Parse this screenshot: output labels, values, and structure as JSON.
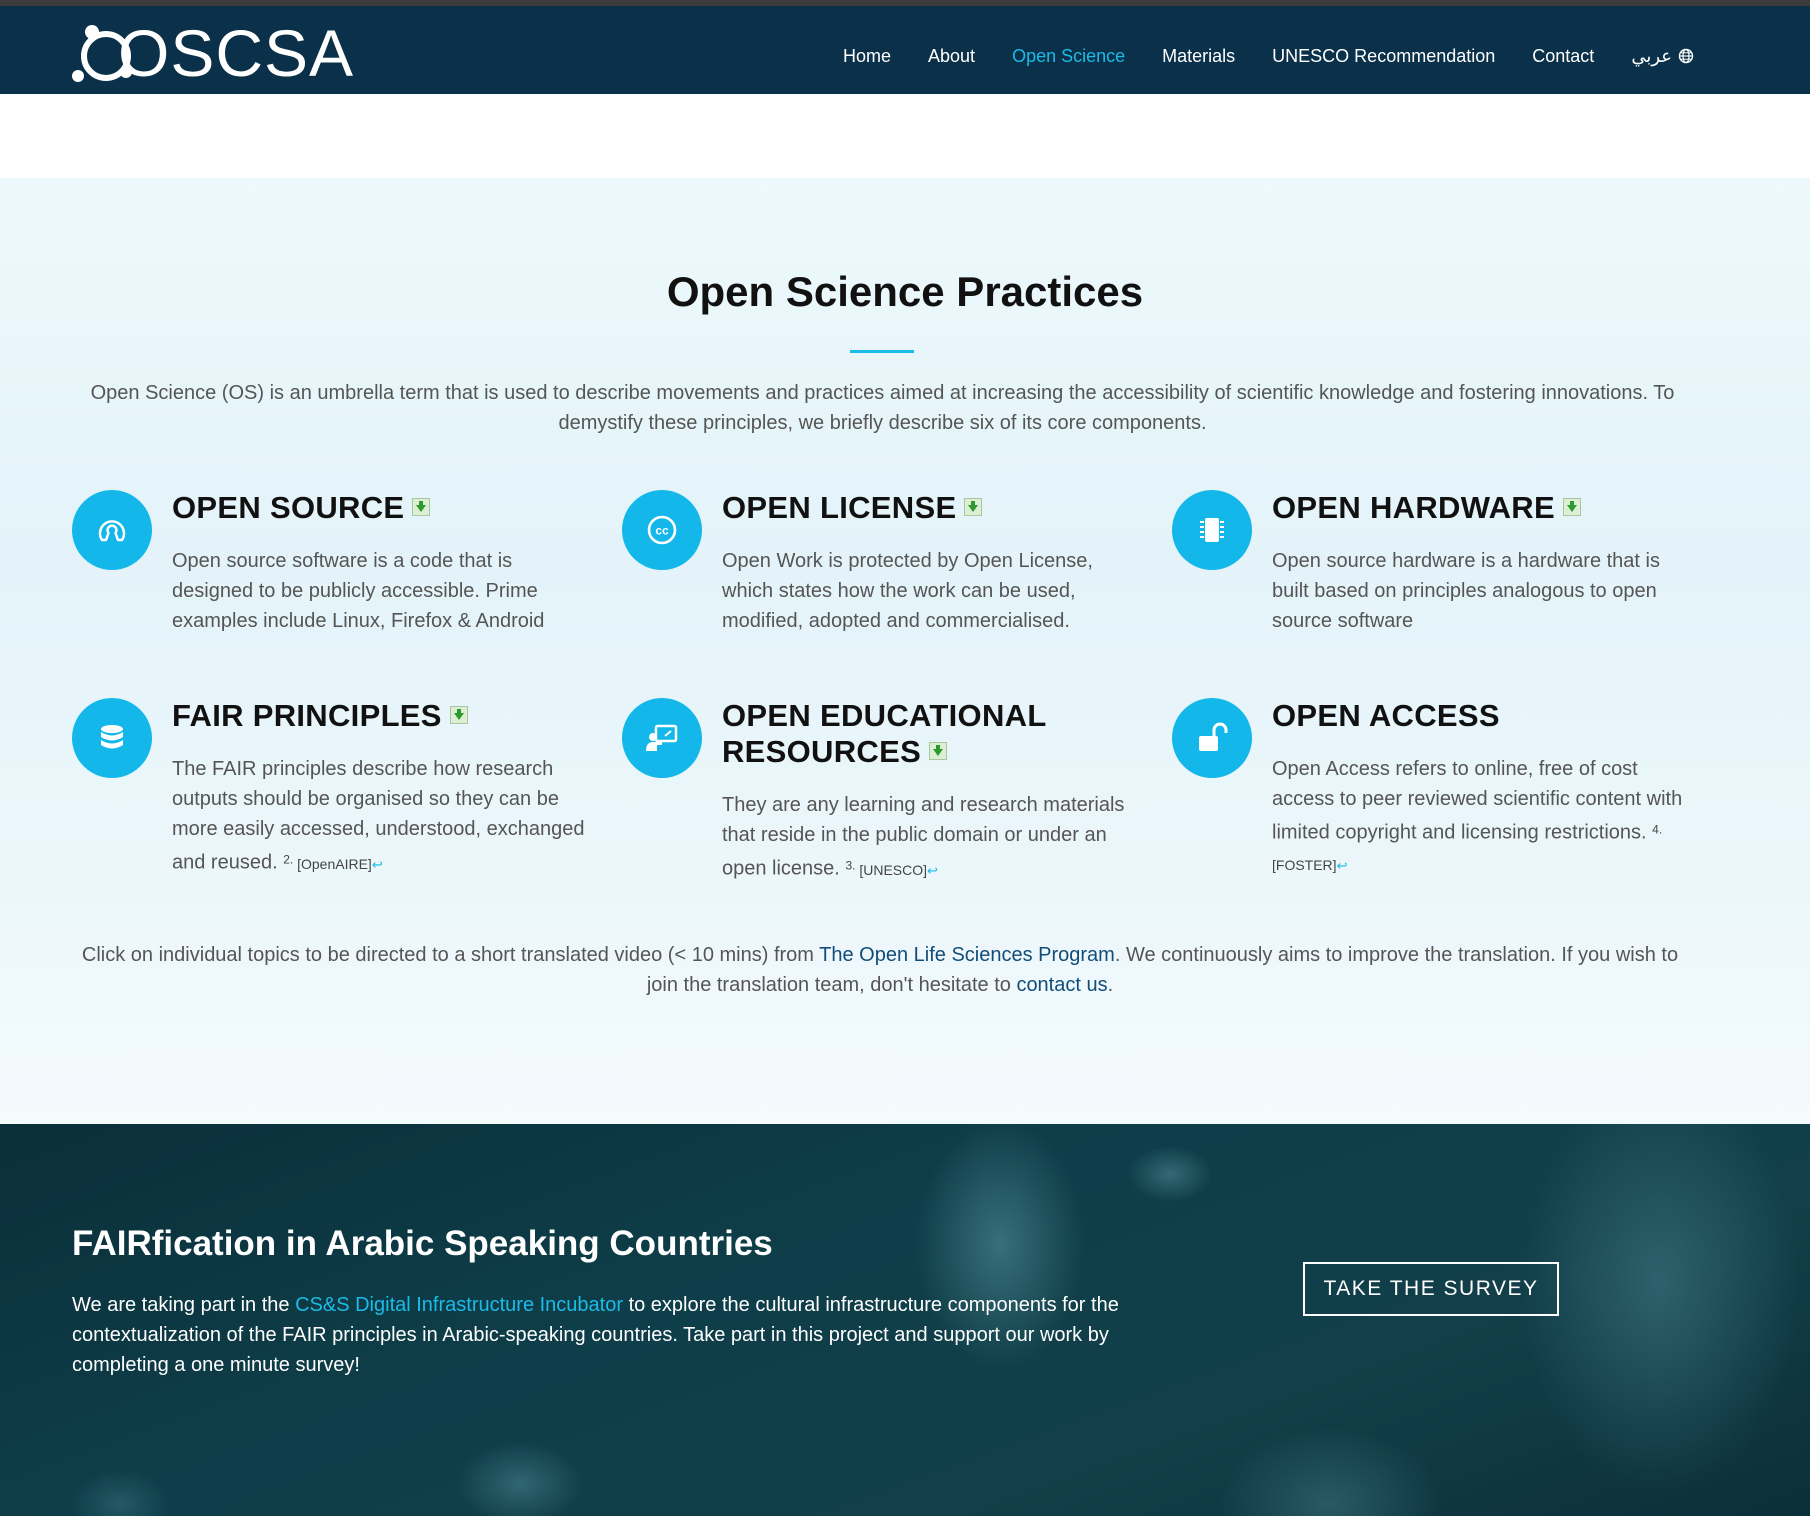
{
  "brand": {
    "name": "OSCSA"
  },
  "nav": {
    "items": [
      {
        "label": "Home",
        "active": false
      },
      {
        "label": "About",
        "active": false
      },
      {
        "label": "Open Science",
        "active": true
      },
      {
        "label": "Materials",
        "active": false
      },
      {
        "label": "UNESCO Recommendation",
        "active": false
      },
      {
        "label": "Contact",
        "active": false
      }
    ],
    "language": {
      "label": "عربي",
      "icon": "globe-icon"
    }
  },
  "practices": {
    "title": "Open Science Practices",
    "intro": "Open Science (OS) is an umbrella term that is used to describe movements and practices aimed at increasing the accessibility of scientific knowledge and fostering innovations. To demystify these principles, we briefly describe six of its core components.",
    "cards": [
      {
        "title": "OPEN SOURCE",
        "icon": "open-source-icon",
        "download": true,
        "text": "Open source software is a code that is designed to be publicly accessible. Prime examples include Linux, Firefox & Android"
      },
      {
        "title": "OPEN LICENSE",
        "icon": "creative-commons-icon",
        "download": true,
        "text": "Open Work is protected by Open License, which states how the work can be used, modified, adopted and commercialised."
      },
      {
        "title": "OPEN HARDWARE",
        "icon": "chip-icon",
        "download": true,
        "text": "Open source hardware is a hardware that is built based on principles analogous to open source software"
      },
      {
        "title": "FAIR PRINCIPLES",
        "icon": "database-icon",
        "download": true,
        "text": "The FAIR principles describe how research outputs should be organised so they can be more easily accessed, understood, exchanged and reused.",
        "ref_num": "2.",
        "ref_label": "[OpenAIRE]",
        "ref_return": "↩"
      },
      {
        "title": "OPEN EDUCATIONAL RESOURCES",
        "icon": "teacher-board-icon",
        "download": true,
        "text": "They are any learning and research materials that reside in the public domain or under an open license.",
        "ref_num": "3.",
        "ref_label": "[UNESCO]",
        "ref_return": "↩"
      },
      {
        "title": "OPEN ACCESS",
        "icon": "unlock-icon",
        "download": false,
        "text": "Open Access refers to online, free of cost access to peer reviewed scientific content with limited copyright and licensing restrictions.",
        "ref_num": "4.",
        "ref_label": "[FOSTER]",
        "ref_return": "↩"
      }
    ],
    "footnote": {
      "before": "Click on individual topics to be directed to a short translated video (< 10 mins) from ",
      "link1": "The Open Life Sciences Program",
      "middle": ". We continuously aims to improve the translation. If you wish to join the translation team, don't hesitate to ",
      "link2": "contact us",
      "after": "."
    }
  },
  "banner": {
    "title": "FAIRfication in Arabic Speaking Countries",
    "text_before": "We are taking part in the ",
    "link": "CS&S Digital Infrastructure Incubator",
    "text_after": " to explore the cultural infrastructure components for the contextualization of the FAIR principles in Arabic-speaking countries. Take part in this project and support our work by completing a one minute survey!",
    "button": "TAKE THE SURVEY"
  },
  "colors": {
    "navbar": "#0a3149",
    "accent": "#1bbbe8",
    "icon_circle": "#14b7e9",
    "link_dark": "#114d78"
  }
}
